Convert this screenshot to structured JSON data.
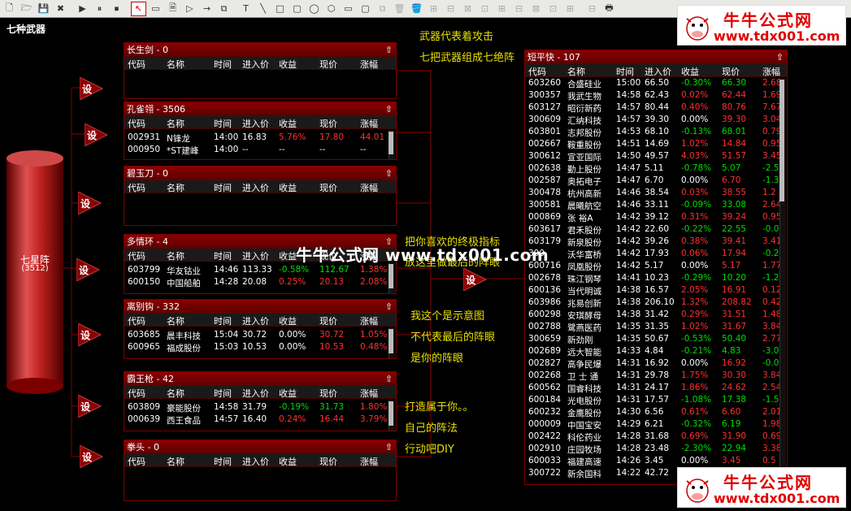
{
  "toolbar": {
    "icons": [
      "new-doc-icon",
      "open-folder-icon",
      "save-icon",
      "close-x-icon",
      "play-icon",
      "pause-icon",
      "stop-icon",
      "select-arrow-icon",
      "rect-select-icon",
      "doc-icon",
      "triangle-icon",
      "arrow-right-icon",
      "copy-icon",
      "text-tool-icon",
      "line-tool-icon",
      "rect-tool-icon",
      "roundrect-tool-icon",
      "ellipse-tool-icon",
      "hexagon-tool-icon",
      "rect2-tool-icon",
      "rounded-tool-icon",
      "copy2-icon",
      "delete-icon",
      "paint-bucket-icon",
      "align1-icon",
      "align2-icon",
      "align3-icon",
      "align4-icon",
      "align5-icon",
      "align6-icon",
      "align7-icon",
      "align8-icon",
      "align9-icon",
      "align10-icon",
      "printer-icon"
    ]
  },
  "title": "七种武器",
  "brand": {
    "cn": "牛牛公式网",
    "url": "www.tdx001.com"
  },
  "watermark": "牛牛公式网  www.tdx001.com",
  "cylinder": {
    "name": "七星阵",
    "count": "(3512)"
  },
  "set_label": "设",
  "notes": {
    "n1": "武器代表着攻击",
    "n2": "七把武器组成七绝阵",
    "n3": "把你喜欢的终极指标",
    "n4": "放这里做最后的阵眼",
    "n5": "我这个是示意图",
    "n6": "不代表最后的阵眼",
    "n7": "是你的阵眼",
    "n8": "打造属于你。。",
    "n9": "自己的阵法",
    "n10": "行动吧DIY"
  },
  "columns": [
    "代码",
    "名称",
    "时间",
    "进入价",
    "收益",
    "现价",
    "涨幅"
  ],
  "up_arrow": "⇧",
  "panels": [
    {
      "title": "长生剑 - 0",
      "rows": []
    },
    {
      "title": "孔雀翎 - 3506",
      "rows": [
        {
          "code": "002931",
          "name": "N锋龙",
          "time": "14:00",
          "entry": "16.83",
          "gain": "5.76%",
          "price": "17.80",
          "chg": "44.01"
        },
        {
          "code": "000950",
          "name": "*ST建峰",
          "time": "14:00",
          "entry": "--",
          "gain": "--",
          "price": "--",
          "chg": "--"
        }
      ]
    },
    {
      "title": "碧玉刀 - 0",
      "rows": []
    },
    {
      "title": "多情环 - 4",
      "rows": [
        {
          "code": "603799",
          "name": "华友钴业",
          "time": "14:46",
          "entry": "113.33",
          "gain": "-0.58%",
          "price": "112.67",
          "chg": "1.38%"
        },
        {
          "code": "600150",
          "name": "中国船舶",
          "time": "14:28",
          "entry": "20.08",
          "gain": "0.25%",
          "price": "20.13",
          "chg": "2.08%"
        }
      ]
    },
    {
      "title": "离别钩 - 332",
      "rows": [
        {
          "code": "603685",
          "name": "晨丰科技",
          "time": "15:04",
          "entry": "30.72",
          "gain": "0.00%",
          "price": "30.72",
          "chg": "1.05%"
        },
        {
          "code": "600965",
          "name": "福成股份",
          "time": "15:03",
          "entry": "10.53",
          "gain": "0.00%",
          "price": "10.53",
          "chg": "0.48%"
        }
      ]
    },
    {
      "title": "霸王枪 - 42",
      "rows": [
        {
          "code": "603809",
          "name": "豪能股份",
          "time": "14:58",
          "entry": "31.79",
          "gain": "-0.19%",
          "price": "31.73",
          "chg": "1.80%"
        },
        {
          "code": "000639",
          "name": "西王食品",
          "time": "14:57",
          "entry": "16.40",
          "gain": "0.24%",
          "price": "16.44",
          "chg": "3.79%"
        }
      ]
    },
    {
      "title": "拳头 - 0",
      "rows": []
    }
  ],
  "big": {
    "title": "短平快 - 107",
    "rows": [
      {
        "code": "603260",
        "name": "合盛硅业",
        "time": "15:00",
        "entry": "66.50",
        "gain": "-0.30%",
        "price": "66.30",
        "chg": "2.68"
      },
      {
        "code": "300357",
        "name": "我武生物",
        "time": "14:58",
        "entry": "62.43",
        "gain": "0.02%",
        "price": "62.44",
        "chg": "1.69"
      },
      {
        "code": "603127",
        "name": "昭衍新药",
        "time": "14:57",
        "entry": "80.44",
        "gain": "0.40%",
        "price": "80.76",
        "chg": "7.67"
      },
      {
        "code": "300609",
        "name": "汇纳科技",
        "time": "14:57",
        "entry": "39.30",
        "gain": "0.00%",
        "price": "39.30",
        "chg": "3.04"
      },
      {
        "code": "603801",
        "name": "志邦股份",
        "time": "14:53",
        "entry": "68.10",
        "gain": "-0.13%",
        "price": "68.01",
        "chg": "0.79"
      },
      {
        "code": "002667",
        "name": "鞍重股份",
        "time": "14:51",
        "entry": "14.69",
        "gain": "1.02%",
        "price": "14.84",
        "chg": "0.95"
      },
      {
        "code": "300612",
        "name": "宣亚国际",
        "time": "14:50",
        "entry": "49.57",
        "gain": "4.03%",
        "price": "51.57",
        "chg": "3.45"
      },
      {
        "code": "002638",
        "name": "勤上股份",
        "time": "14:47",
        "entry": "5.11",
        "gain": "-0.78%",
        "price": "5.07",
        "chg": "-2.5"
      },
      {
        "code": "002587",
        "name": "奥拓电子",
        "time": "14:47",
        "entry": "6.70",
        "gain": "0.00%",
        "price": "6.70",
        "chg": "-1.3"
      },
      {
        "code": "300478",
        "name": "杭州高新",
        "time": "14:46",
        "entry": "38.54",
        "gain": "0.03%",
        "price": "38.55",
        "chg": "1.2"
      },
      {
        "code": "300581",
        "name": "晨曦航空",
        "time": "14:46",
        "entry": "33.11",
        "gain": "-0.09%",
        "price": "33.08",
        "chg": "2.64"
      },
      {
        "code": "000869",
        "name": "张 裕A",
        "time": "14:42",
        "entry": "39.12",
        "gain": "0.31%",
        "price": "39.24",
        "chg": "0.95"
      },
      {
        "code": "603617",
        "name": "君禾股份",
        "time": "14:42",
        "entry": "22.60",
        "gain": "-0.22%",
        "price": "22.55",
        "chg": "-0.0"
      },
      {
        "code": "603179",
        "name": "新泉股份",
        "time": "14:42",
        "entry": "39.26",
        "gain": "0.38%",
        "price": "39.41",
        "chg": "3.41"
      },
      {
        "code": "300",
        "name": "沃华富桥",
        "time": "14:42",
        "entry": "17.93",
        "gain": "0.06%",
        "price": "17.94",
        "chg": "-0.2"
      },
      {
        "code": "600716",
        "name": "凤凰股份",
        "time": "14:42",
        "entry": "5.17",
        "gain": "0.00%",
        "price": "5.17",
        "chg": "1.77"
      },
      {
        "code": "002678",
        "name": "珠江钢琴",
        "time": "14:41",
        "entry": "10.23",
        "gain": "-0.29%",
        "price": "10.20",
        "chg": "-1.2"
      },
      {
        "code": "600136",
        "name": "当代明诚",
        "time": "14:38",
        "entry": "16.57",
        "gain": "2.05%",
        "price": "16.91",
        "chg": "0.12"
      },
      {
        "code": "603986",
        "name": "兆易创新",
        "time": "14:38",
        "entry": "206.10",
        "gain": "1.32%",
        "price": "208.82",
        "chg": "0.42"
      },
      {
        "code": "600298",
        "name": "安琪酵母",
        "time": "14:38",
        "entry": "31.42",
        "gain": "0.29%",
        "price": "31.51",
        "chg": "1.48"
      },
      {
        "code": "002788",
        "name": "鹭燕医药",
        "time": "14:35",
        "entry": "31.35",
        "gain": "1.02%",
        "price": "31.67",
        "chg": "3.84"
      },
      {
        "code": "300659",
        "name": "新劲刚",
        "time": "14:35",
        "entry": "50.67",
        "gain": "-0.53%",
        "price": "50.40",
        "chg": "2.77"
      },
      {
        "code": "002689",
        "name": "远大智能",
        "time": "14:33",
        "entry": "4.84",
        "gain": "-0.21%",
        "price": "4.83",
        "chg": "-3.0"
      },
      {
        "code": "002827",
        "name": "高争民爆",
        "time": "14:31",
        "entry": "16.92",
        "gain": "0.00%",
        "price": "16.92",
        "chg": "-0.0"
      },
      {
        "code": "002268",
        "name": "卫 士 通",
        "time": "14:31",
        "entry": "29.78",
        "gain": "1.75%",
        "price": "30.30",
        "chg": "3.84"
      },
      {
        "code": "600562",
        "name": "国睿科技",
        "time": "14:31",
        "entry": "24.17",
        "gain": "1.86%",
        "price": "24.62",
        "chg": "2.54"
      },
      {
        "code": "600184",
        "name": "光电股份",
        "time": "14:31",
        "entry": "17.57",
        "gain": "-1.08%",
        "price": "17.38",
        "chg": "-1.5"
      },
      {
        "code": "600232",
        "name": "金鹰股份",
        "time": "14:30",
        "entry": "6.56",
        "gain": "0.61%",
        "price": "6.60",
        "chg": "2.01"
      },
      {
        "code": "000009",
        "name": "中国宝安",
        "time": "14:29",
        "entry": "6.21",
        "gain": "-0.32%",
        "price": "6.19",
        "chg": "1.98"
      },
      {
        "code": "002422",
        "name": "科伦药业",
        "time": "14:28",
        "entry": "31.68",
        "gain": "0.69%",
        "price": "31.90",
        "chg": "0.69"
      },
      {
        "code": "002910",
        "name": "庄园牧场",
        "time": "14:28",
        "entry": "23.48",
        "gain": "-2.30%",
        "price": "22.94",
        "chg": "3.38"
      },
      {
        "code": "600033",
        "name": "福建高速",
        "time": "14:26",
        "entry": "3.45",
        "gain": "0.00%",
        "price": "3.45",
        "chg": "0.5"
      },
      {
        "code": "300722",
        "name": "新余国科",
        "time": "14:22",
        "entry": "42.72",
        "gain": "",
        "price": "",
        "chg": ""
      }
    ]
  },
  "colors": {
    "up": "#ff3030",
    "down": "#00dd00",
    "flat": "#ffffff",
    "panel_red": "#8b0000",
    "note": "#e8e000"
  }
}
